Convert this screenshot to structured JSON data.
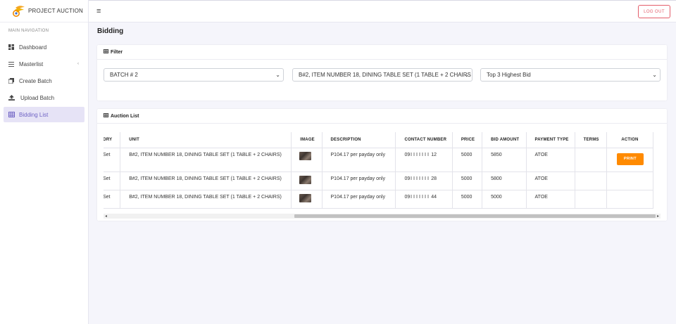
{
  "app": {
    "name": "PROJECT AUCTION"
  },
  "sidebar": {
    "header": "MAIN NAVIGATION",
    "items": [
      {
        "label": "Dashboard",
        "icon": "dashboard-icon"
      },
      {
        "label": "Masterlist",
        "icon": "list-icon"
      },
      {
        "label": "Create Batch",
        "icon": "copy-icon"
      },
      {
        "label": "Upload Batch",
        "icon": "upload-icon"
      },
      {
        "label": "Bidding List",
        "icon": "table-icon"
      }
    ]
  },
  "topbar": {
    "logout_label": "LOG OUT"
  },
  "page": {
    "title": "Bidding"
  },
  "filter": {
    "title": "Filter",
    "batch": "BATCH # 2",
    "item": "B#2, ITEM NUMBER 18, DINING TABLE SET (1 TABLE + 2 CHAIRS",
    "bid_filter": "Top 3 Highest Bid"
  },
  "auction": {
    "title": "Auction List",
    "columns": [
      "ORY",
      "UNIT",
      "IMAGE",
      "DESCRIPTION",
      "CONTACT NUMBER",
      "PRICE",
      "BID AMOUNT",
      "PAYMENT TYPE",
      "TERMS",
      "ACTION"
    ],
    "rows": [
      {
        "category": "Set",
        "unit": "B#2, ITEM NUMBER 18, DINING TABLE SET (1 TABLE + 2 CHAIRS)",
        "description": "P104.17 per payday only",
        "contact_prefix": "09",
        "contact_suffix": "12",
        "price": "5000",
        "bid_amount": "5850",
        "payment_type": "ATOE",
        "terms": "",
        "action": "PRINT"
      },
      {
        "category": "Set",
        "unit": "B#2, ITEM NUMBER 18, DINING TABLE SET (1 TABLE + 2 CHAIRS)",
        "description": "P104.17 per payday only",
        "contact_prefix": "09",
        "contact_suffix": "28",
        "price": "5000",
        "bid_amount": "5800",
        "payment_type": "ATOE",
        "terms": ""
      },
      {
        "category": "Set",
        "unit": "B#2, ITEM NUMBER 18, DINING TABLE SET (1 TABLE + 2 CHAIRS)",
        "description": "P104.17 per payday only",
        "contact_prefix": "09",
        "contact_suffix": "44",
        "price": "5000",
        "bid_amount": "5000",
        "payment_type": "ATOE",
        "terms": ""
      }
    ]
  },
  "colors": {
    "accent": "#6f63c4",
    "print": "#ff8a00",
    "logout": "#e35d6a"
  }
}
